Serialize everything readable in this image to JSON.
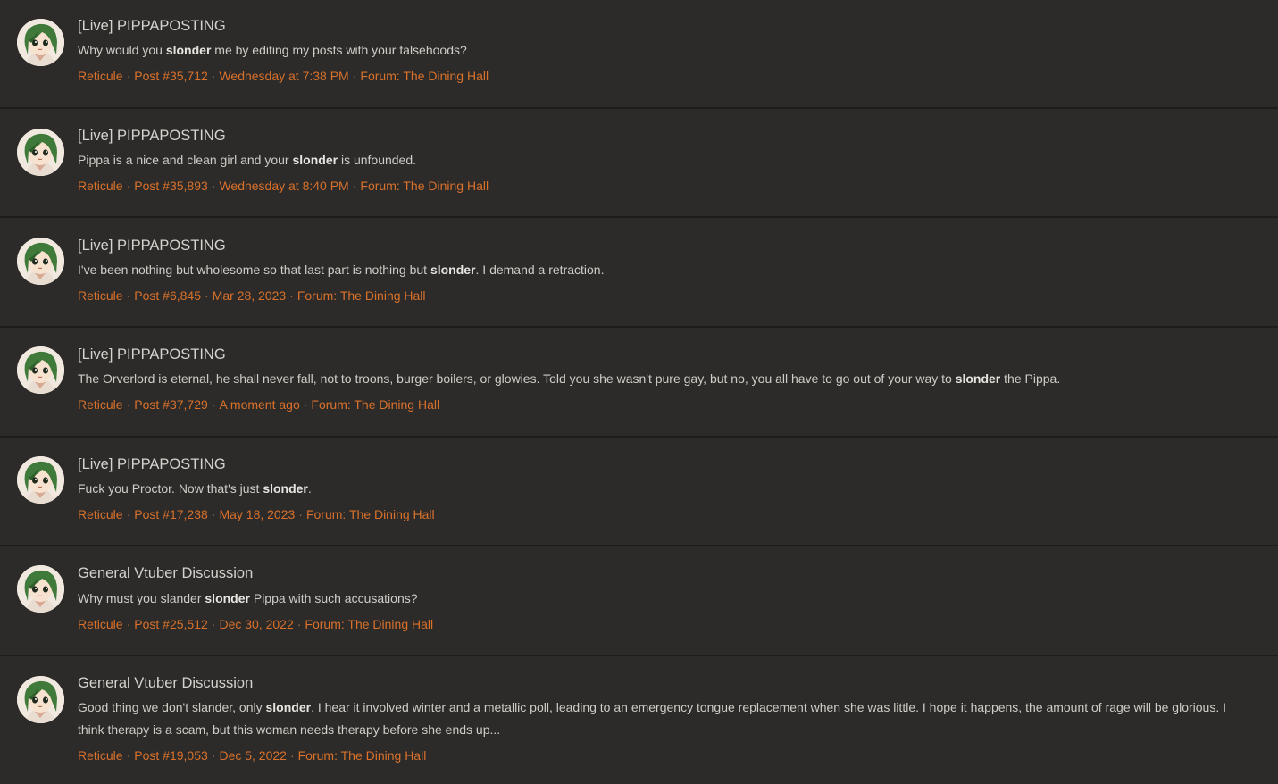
{
  "colors": {
    "background": "#2d2b29",
    "divider": "#1e1d1c",
    "title_text": "#d6d3cf",
    "snippet_text": "#d0ccc7",
    "meta_accent": "#d9712b"
  },
  "avatar_icon": "anime-girl-avatar-icon",
  "results": [
    {
      "title": "[Live] PIPPAPOSTING",
      "snippet_before": "Why would you ",
      "highlight": "slonder",
      "snippet_after": " me by editing my posts with your falsehoods?",
      "author": "Reticule",
      "post": "Post #35,712",
      "date": "Wednesday at 7:38 PM",
      "forum": "Forum: The Dining Hall"
    },
    {
      "title": "[Live] PIPPAPOSTING",
      "snippet_before": "Pippa is a nice and clean girl and your ",
      "highlight": "slonder",
      "snippet_after": " is unfounded.",
      "author": "Reticule",
      "post": "Post #35,893",
      "date": "Wednesday at 8:40 PM",
      "forum": "Forum: The Dining Hall"
    },
    {
      "title": "[Live] PIPPAPOSTING",
      "snippet_before": "I've been nothing but wholesome so that last part is nothing but ",
      "highlight": "slonder",
      "snippet_after": ". I demand a retraction.",
      "author": "Reticule",
      "post": "Post #6,845",
      "date": "Mar 28, 2023",
      "forum": "Forum: The Dining Hall"
    },
    {
      "title": "[Live] PIPPAPOSTING",
      "snippet_before": "The Orverlord is eternal, he shall never fall, not to troons, burger boilers, or glowies. Told you she wasn't pure gay, but no, you all have to go out of your way to ",
      "highlight": "slonder",
      "snippet_after": " the Pippa.",
      "author": "Reticule",
      "post": "Post #37,729",
      "date": "A moment ago",
      "forum": "Forum: The Dining Hall"
    },
    {
      "title": "[Live] PIPPAPOSTING",
      "snippet_before": "Fuck you Proctor. Now that's just ",
      "highlight": "slonder",
      "snippet_after": ".",
      "author": "Reticule",
      "post": "Post #17,238",
      "date": "May 18, 2023",
      "forum": "Forum: The Dining Hall"
    },
    {
      "title": "General Vtuber Discussion",
      "snippet_before": "Why must you slander ",
      "highlight": "slonder",
      "snippet_after": " Pippa with such accusations?",
      "author": "Reticule",
      "post": "Post #25,512",
      "date": "Dec 30, 2022",
      "forum": "Forum: The Dining Hall"
    },
    {
      "title": "General Vtuber Discussion",
      "snippet_before": "Good thing we don't slander, only ",
      "highlight": "slonder",
      "snippet_after": ". I hear it involved winter and a metallic poll, leading to an emergency tongue replacement when she was little. I hope it happens, the amount of rage will be glorious. I think therapy is a scam, but this woman needs therapy before she ends up...",
      "author": "Reticule",
      "post": "Post #19,053",
      "date": "Dec 5, 2022",
      "forum": "Forum: The Dining Hall"
    }
  ]
}
